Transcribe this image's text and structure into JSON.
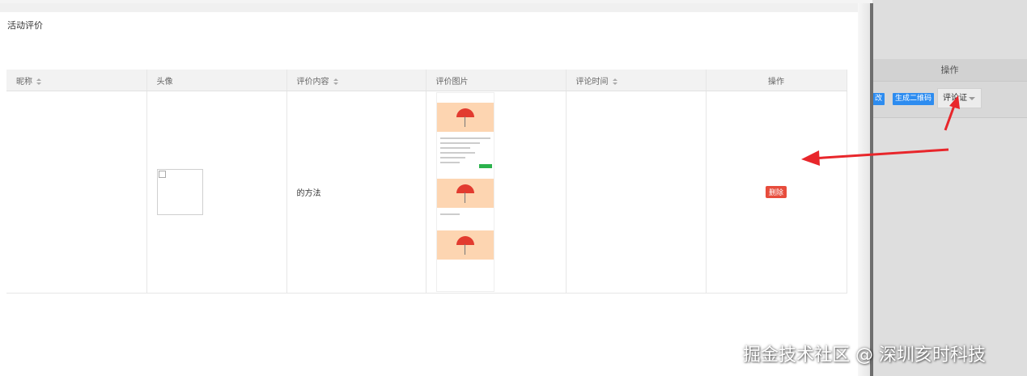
{
  "page": {
    "title": "活动评价"
  },
  "table": {
    "columns": [
      {
        "label": "昵称",
        "sortable": true
      },
      {
        "label": "头像",
        "sortable": false
      },
      {
        "label": "评价内容",
        "sortable": true
      },
      {
        "label": "评价图片",
        "sortable": false
      },
      {
        "label": "评论时间",
        "sortable": true
      },
      {
        "label": "操作",
        "sortable": false
      }
    ],
    "rows": [
      {
        "nickname": "",
        "content": "的方法",
        "time": "",
        "delete_label": "删除"
      }
    ]
  },
  "background_page": {
    "op_header": "操作",
    "btn_modify": "改",
    "btn_qrcode": "生成二维码",
    "select_value": "评论证"
  },
  "watermark": "掘金技术社区 @ 深圳亥时科技",
  "colors": {
    "delete": "#e74c3c",
    "primary": "#2d8cf0",
    "annotation_arrow": "#e8262b"
  }
}
